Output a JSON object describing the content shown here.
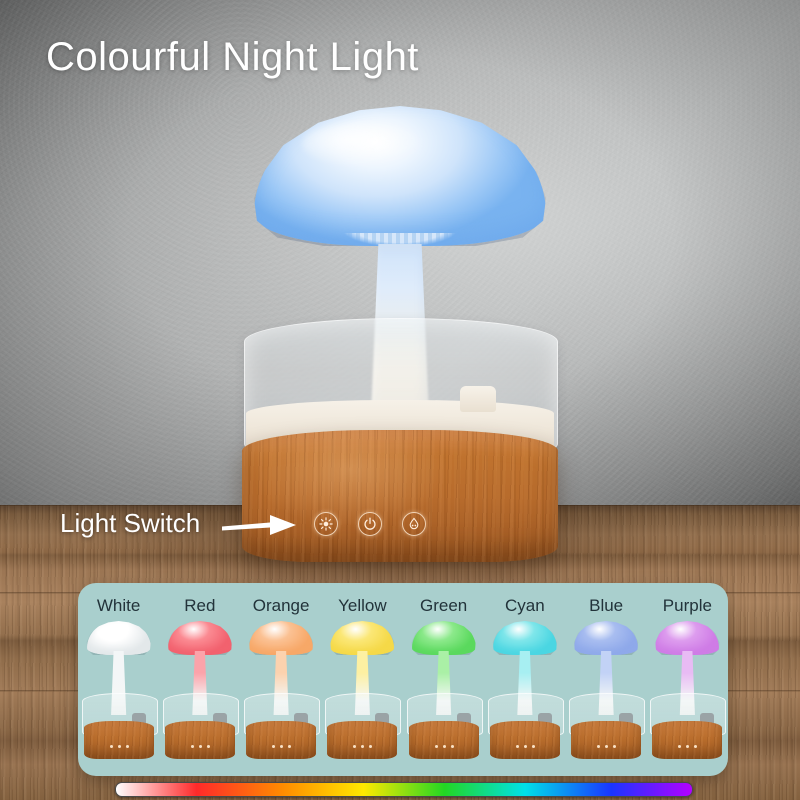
{
  "page_title": "Colourful Night Light",
  "callout": {
    "label": "Light Switch",
    "arrow_icon": "arrow-right-icon"
  },
  "product": {
    "name": "mushroom-rain-cloud-humidifier",
    "cap_color": "#9cc8f6",
    "base_color": "#b76b2c",
    "controls": [
      {
        "name": "light-button",
        "icon": "sun-burst-icon"
      },
      {
        "name": "power-button",
        "icon": "power-icon"
      },
      {
        "name": "mist-button",
        "icon": "water-droplet-icon"
      }
    ]
  },
  "swatch_panel": {
    "background_color": "#a9cfcd",
    "colors": [
      {
        "label": "White",
        "cap": "#ffffff",
        "cap_dark": "#e3e8ea",
        "stem": "#f3f6f7"
      },
      {
        "label": "Red",
        "cap": "#fb8a92",
        "cap_dark": "#f2626f",
        "stem": "#fba3aa"
      },
      {
        "label": "Orange",
        "cap": "#fbc193",
        "cap_dark": "#f7a868",
        "stem": "#fcd2ae"
      },
      {
        "label": "Yellow",
        "cap": "#fbe776",
        "cap_dark": "#f5d948",
        "stem": "#fdf0a2"
      },
      {
        "label": "Green",
        "cap": "#8ce98b",
        "cap_dark": "#5bd95e",
        "stem": "#aaf0a6"
      },
      {
        "label": "Cyan",
        "cap": "#7fe6ea",
        "cap_dark": "#4bd6e2",
        "stem": "#a7efF2"
      },
      {
        "label": "Blue",
        "cap": "#a8bdf0",
        "cap_dark": "#8fa9ea",
        "stem": "#c2d2f6"
      },
      {
        "label": "Purple",
        "cap": "#dd9cee",
        "cap_dark": "#cf7ce6",
        "stem": "#e8bbf4"
      }
    ]
  },
  "rainbow_bar": {
    "name": "colour-gradient-bar",
    "stops": [
      "#ffffff",
      "#ff2a2a",
      "#ff8c00",
      "#ffe800",
      "#23d723",
      "#00e0e8",
      "#1a35ff",
      "#b400ff"
    ]
  }
}
